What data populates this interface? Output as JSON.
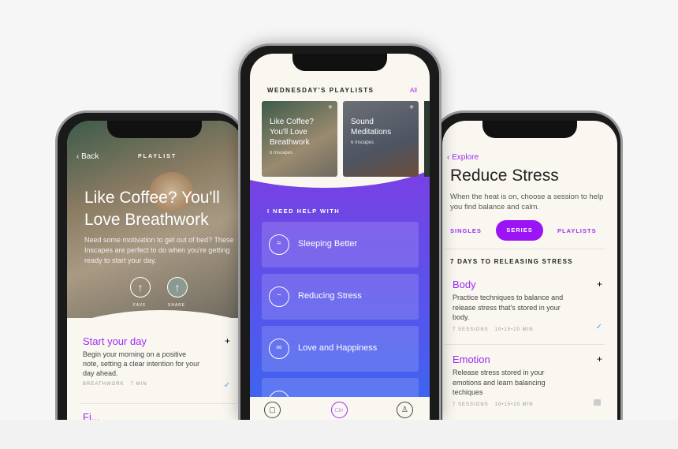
{
  "left_screen": {
    "back_label": "Back",
    "header_label": "PLAYLIST",
    "title": "Like Coffee? You'll Love Breathwork",
    "description": "Need some motivation to get out of bed? These Inscapes are perfect to do when you're getting ready to start your day.",
    "fave_label": "FAVE",
    "share_label": "SHARE",
    "session": {
      "title": "Start your day",
      "description": "Begin your morning on a positive note, setting a clear intention for your day ahead.",
      "meta": "BREATHWORK   7 MIN",
      "completed": true
    },
    "next_title_partial": "Fi..."
  },
  "middle_screen": {
    "section_title": "WEDNESDAY'S PLAYLISTS",
    "all_link": "All",
    "playlists": [
      {
        "title": "Like Coffee? You'll Love Breathwork",
        "count": "6 Inscapes"
      },
      {
        "title": "Sound Meditations",
        "count": "6 Inscapes"
      }
    ],
    "help_title": "I NEED HELP WITH",
    "help_items": [
      {
        "label": "Sleeping Better",
        "icon": "sleep-icon"
      },
      {
        "label": "Reducing Stress",
        "icon": "wave-icon"
      },
      {
        "label": "Love and Happiness",
        "icon": "rings-icon"
      },
      {
        "label": "",
        "icon": "star-icon"
      }
    ],
    "nav": [
      "lock-icon",
      "inscape-icon",
      "profile-icon"
    ]
  },
  "right_screen": {
    "back_label": "Explore",
    "title": "Reduce Stress",
    "description": "When the heat is on, choose a session to help you find balance and calm.",
    "tabs": [
      "SINGLES",
      "SERIES",
      "PLAYLISTS"
    ],
    "active_tab": "SERIES",
    "series_title": "7 DAYS TO RELEASING STRESS",
    "items": [
      {
        "title": "Body",
        "description": "Practice techniques to balance and release stress that's stored in your body.",
        "meta": "7 SESSIONS   10•15•20 MIN",
        "status": "completed"
      },
      {
        "title": "Emotion",
        "description": "Release stress stored in your emotions and learn balancing techiques",
        "meta": "7 SESSIONS   10•15•20 MIN",
        "status": "locked"
      }
    ]
  },
  "colors": {
    "accent": "#9b2cf5",
    "cream": "#faf7f1",
    "gradient_top": "#7b3fe4",
    "gradient_bottom": "#3f63f0",
    "check": "#4aa8e8"
  }
}
